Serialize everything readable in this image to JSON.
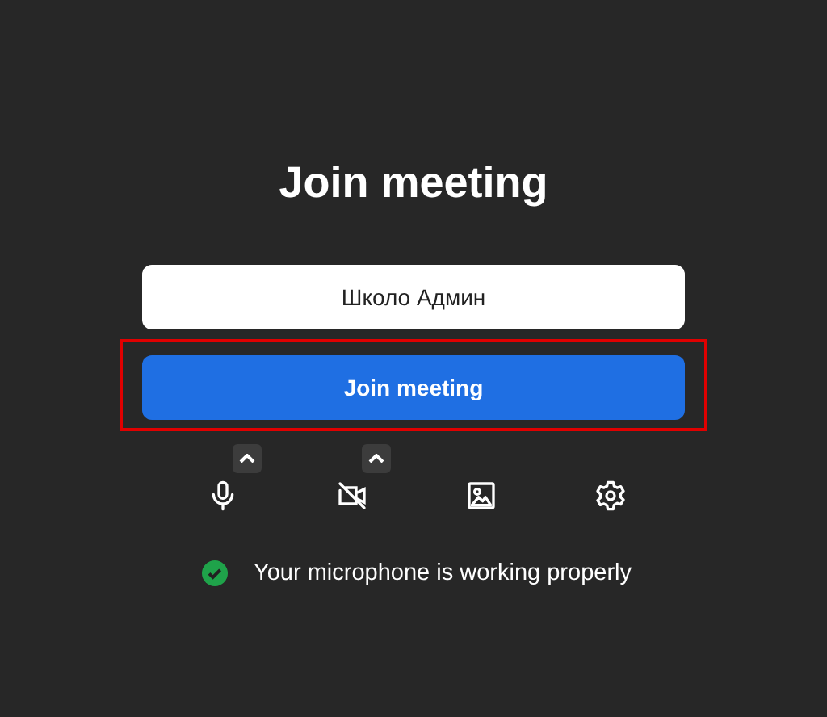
{
  "title": "Join meeting",
  "name_field": {
    "value": "Школо Админ"
  },
  "join_button": {
    "label": "Join meeting",
    "highlighted": true
  },
  "controls": [
    {
      "kind": "mic",
      "has_menu": true
    },
    {
      "kind": "camera-off",
      "has_menu": true
    },
    {
      "kind": "background",
      "has_menu": false
    },
    {
      "kind": "settings",
      "has_menu": false
    }
  ],
  "status": {
    "ok": true,
    "text": "Your microphone is working properly"
  }
}
